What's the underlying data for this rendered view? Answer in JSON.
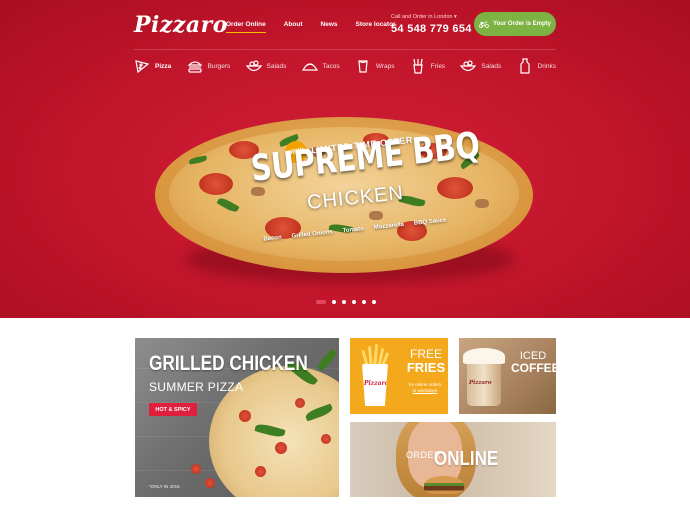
{
  "header": {
    "logo": "Pizzaro",
    "nav": [
      "Order Online",
      "About",
      "News",
      "Store locator"
    ],
    "contact_label": "Call and Order in London",
    "contact_phone": "54 548 779 654",
    "cart_label": "Your Order is Empty"
  },
  "categories": [
    {
      "label": "Pizza",
      "icon": "pizza-slice-icon"
    },
    {
      "label": "Burgers",
      "icon": "burger-icon"
    },
    {
      "label": "Salads",
      "icon": "salad-bowl-icon"
    },
    {
      "label": "Tacos",
      "icon": "taco-icon"
    },
    {
      "label": "Wraps",
      "icon": "wrap-icon"
    },
    {
      "label": "Fries",
      "icon": "fries-icon"
    },
    {
      "label": "Salads",
      "icon": "salad-bowl-icon"
    },
    {
      "label": "Drinks",
      "icon": "drink-bottle-icon"
    }
  ],
  "hero": {
    "badge": "NEW!",
    "offer": "LIMITED TIME OFFER",
    "title": "SUPREME BBQ",
    "subtitle": "CHICKEN",
    "ingredients": [
      "Bacon",
      "Grilled Onions",
      "Tomato",
      "Mozzarella",
      "BBQ Sauce"
    ],
    "slides": 6,
    "active_slide": 1
  },
  "tiles": {
    "grilled": {
      "title": "GRILLED CHICKEN",
      "subtitle": "SUMMER PIZZA",
      "button": "HOT & SPICY",
      "footnote": "*ONLY IN 2016"
    },
    "fries": {
      "line1": "FREE",
      "line2": "FRIES",
      "small1": "for online orders",
      "small2": "in weekdays",
      "brand": "Pizzaro"
    },
    "coffee": {
      "line1": "ICED",
      "line2": "COFFEE",
      "brand": "Pizzaro"
    },
    "online": {
      "small": "ORDER",
      "big": "ONLINE"
    }
  },
  "colors": {
    "brand_red": "#c1152b",
    "cart_green": "#7cb342",
    "fries_orange": "#f4a81c",
    "accent_yellow": "#f2c200"
  }
}
